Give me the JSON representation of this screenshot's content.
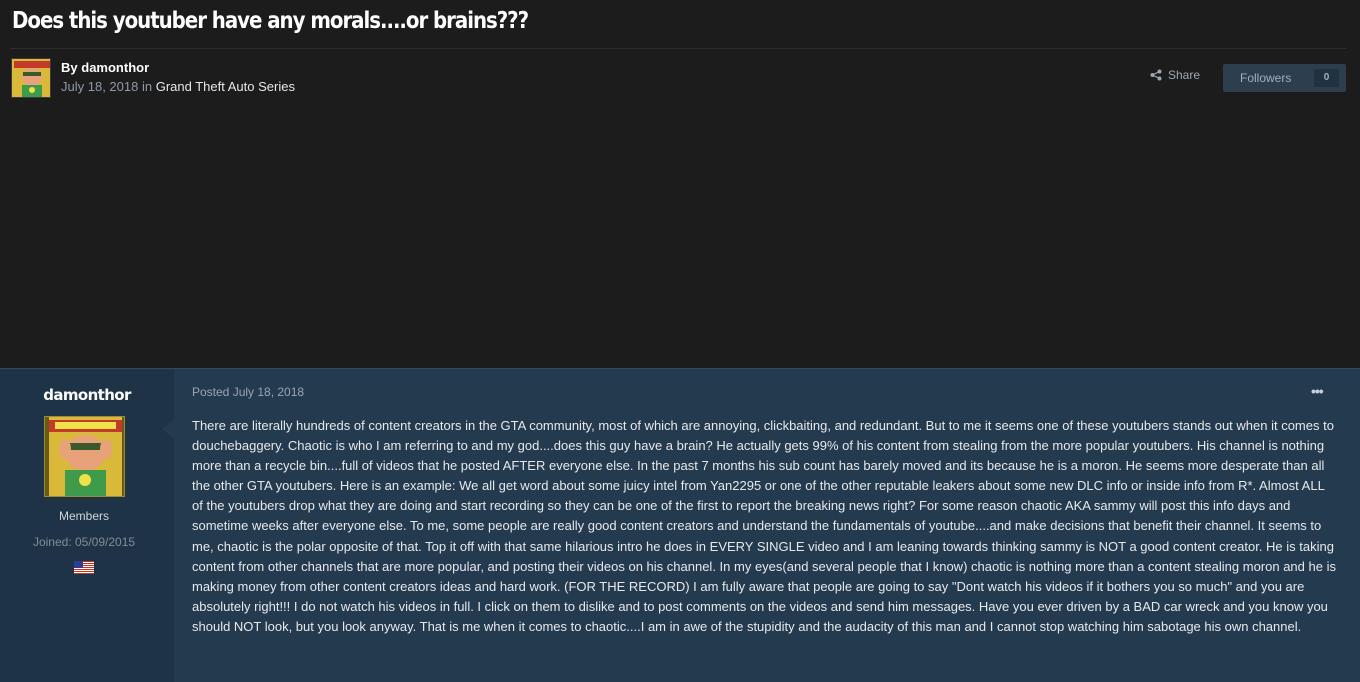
{
  "topic": {
    "title": "Does this youtuber have any morals....or brains???",
    "author_prefix": "By",
    "author": "damonthor",
    "date": "July 18, 2018",
    "in_word": "in",
    "forum": "Grand Theft Auto Series"
  },
  "actions": {
    "share_label": "Share",
    "followers_label": "Followers",
    "followers_count": "0",
    "share_icon": "share-icon"
  },
  "post": {
    "poster_name": "damonthor",
    "group": "Members",
    "joined": "Joined: 05/09/2015",
    "flag_icon": "us-flag-icon",
    "posted": "Posted July 18, 2018",
    "menu": "•••",
    "body": "There are literally hundreds of content creators in the GTA community, most of which are annoying, clickbaiting, and redundant. But to me it seems one of these youtubers stands out when it comes to douchebaggery. Chaotic is who I am referring to and my god....does this guy have a brain? He actually gets 99% of his content from stealing from the more popular youtubers. His channel is nothing more than a recycle bin....full of videos that he posted AFTER everyone else. In the past 7 months his sub count has barely moved and its because he is a moron. He seems more desperate than all the other GTA youtubers. Here is an example: We all get word about some juicy intel from Yan2295 or one of the other reputable leakers about some new DLC info or inside info from R*. Almost ALL of the youtubers drop what they are doing and start recording so they can be one of the first to report the breaking news right? For some reason chaotic AKA sammy will post this info days and sometime weeks after everyone else. To me, some people are really good content creators and understand the fundamentals of youtube....and make decisions that benefit their channel. It seems to me, chaotic is the polar opposite of that. Top it off with that same hilarious intro he does in EVERY SINGLE video and I am leaning towards thinking sammy is NOT a good content creator. He is taking content from other channels that are more popular, and posting their videos on his channel. In my eyes(and several people that I know) chaotic is nothing more than a content stealing moron and he is making money from other content creators ideas and hard work. (FOR THE RECORD) I am fully aware that people are going to say \"Dont watch his videos if it bothers you so much\" and  you are absolutely right!!! I do not watch his videos in full. I click on them to dislike and to post comments on the videos and send him messages. Have you ever driven by a BAD car wreck and you know you should NOT look, but you look anyway. That is me when it comes to chaotic....I am in awe of the stupidity and the audacity of this man and I cannot stop watching him sabotage his own channel."
  },
  "colors": {
    "page_bg": "#1c1c1c",
    "post_bg": "#243a4f",
    "sidebar_bg": "#1f3346",
    "followers_bg": "#2d3e4e"
  }
}
